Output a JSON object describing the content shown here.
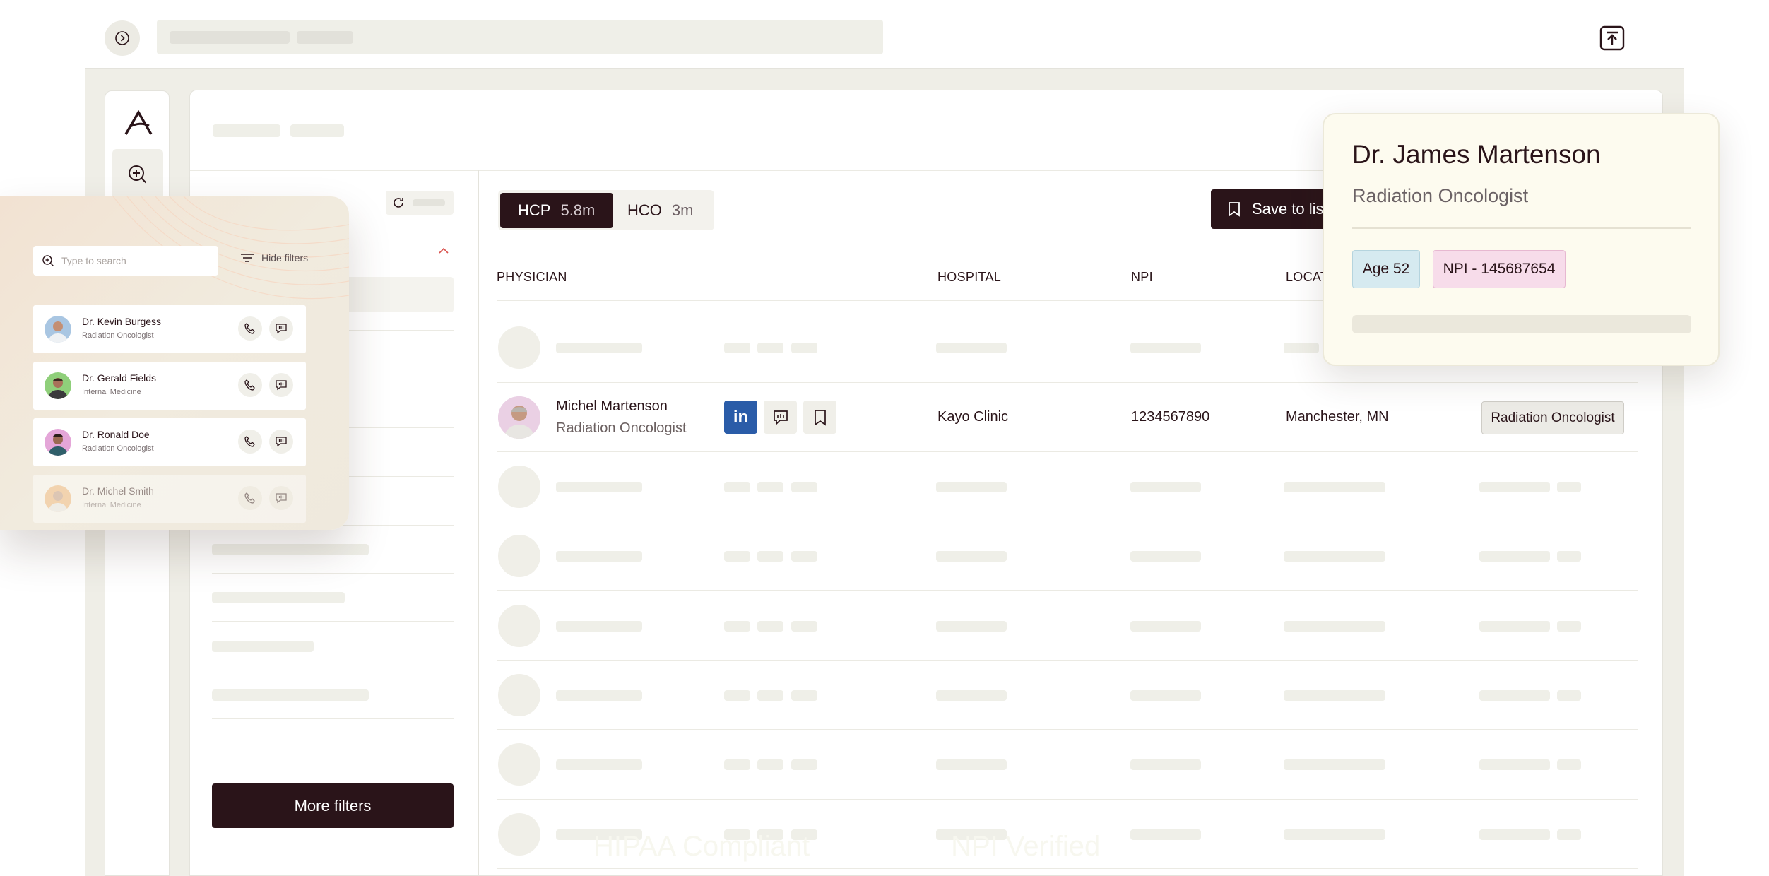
{
  "tabs": {
    "hcp": {
      "label": "HCP",
      "count": "5.8m"
    },
    "hco": {
      "label": "HCO",
      "count": "3m"
    }
  },
  "toolbar": {
    "save_label": "Save to lis"
  },
  "filters": {
    "more_label": "More filters"
  },
  "table": {
    "headers": {
      "physician": "PHYSICIAN",
      "hospital": "HOSPITAL",
      "npi": "NPI",
      "location": "LOCAT"
    },
    "row": {
      "name": "Michel Martenson",
      "specialty": "Radiation Oncologist",
      "linkedin": "in",
      "hospital": "Kayo Clinic",
      "npi": "1234567890",
      "location": "Manchester, MN",
      "specialty_badge": "Radiation Oncologist"
    }
  },
  "left_card": {
    "search_placeholder": "Type to search",
    "hide_filters": "Hide filters",
    "doctors": [
      {
        "name": "Dr. Kevin Burgess",
        "specialty": "Radiation Oncologist"
      },
      {
        "name": "Dr. Gerald Fields",
        "specialty": "Internal Medicine"
      },
      {
        "name": "Dr. Ronald Doe",
        "specialty": "Radiation Oncologist"
      },
      {
        "name": "Dr. Michel Smith",
        "specialty": "Internal Medicine"
      }
    ]
  },
  "profile_card": {
    "name": "Dr. James Martenson",
    "specialty": "Radiation Oncologist",
    "age": "Age 52",
    "npi": "NPI - 145687654"
  },
  "watermark": {
    "hipaa": "HIPAA Compliant",
    "npi": "NPI Verified"
  },
  "colors": {
    "primary": "#2a1419",
    "linkedin": "#2a5ca8",
    "card_bg": "#fdfbef",
    "age_badge": "#d6eaf0",
    "npi_badge": "#f7dcea"
  }
}
